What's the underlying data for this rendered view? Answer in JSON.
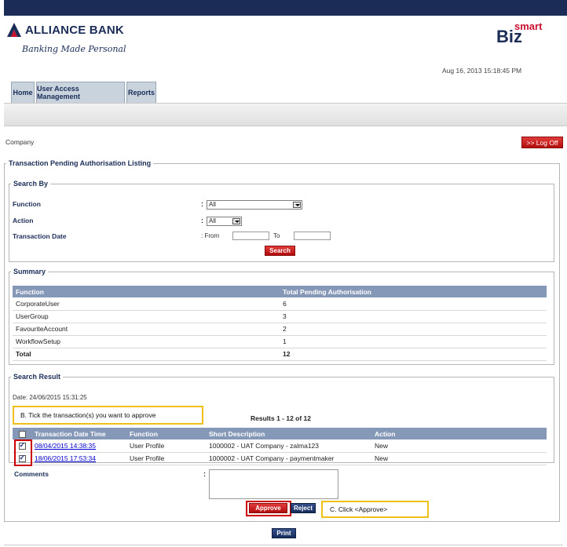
{
  "brand": {
    "name": "ALLIANCE BANK",
    "tagline": "Banking Made Personal",
    "biz": "Biz",
    "smart": "smart"
  },
  "header": {
    "datetime": "Aug 16, 2013 15:18:45 PM"
  },
  "tabs": [
    {
      "label": "Home"
    },
    {
      "label": "User Access Management"
    },
    {
      "label": "Reports"
    }
  ],
  "company_label": "Company",
  "logoff_label": ">> Log Off",
  "page_title": "Transaction Pending Authorisation Listing",
  "search_by": {
    "legend": "Search By",
    "function_label": "Function",
    "function_value": "All",
    "action_label": "Action",
    "action_value": "All",
    "date_label": "Transaction Date",
    "from_label": ": From",
    "to_label": "To",
    "colon": ":",
    "search_button": "Search"
  },
  "summary": {
    "legend": "Summary",
    "headers": [
      "Function",
      "Total Pending Authorisation"
    ],
    "rows": [
      [
        "CorporateUser",
        "6"
      ],
      [
        "UserGroup",
        "3"
      ],
      [
        "FavouriteAccount",
        "2"
      ],
      [
        "WorkflowSetup",
        "1"
      ]
    ],
    "total_label": "Total",
    "total_value": "12"
  },
  "search_result": {
    "legend": "Search Result",
    "date_text": "Date: 24/06/2015 15:31:25",
    "results_text": "Results 1 - 12 of 12",
    "headers": [
      "Transaction Date Time",
      "Function",
      "Short Description",
      "Action"
    ],
    "rows": [
      [
        "08/04/2015 14:38:35",
        "User Profile",
        "1000002 - UAT Company - zalma123",
        "New"
      ],
      [
        "18/06/2015 17:53:34",
        "User Profile",
        "1000002 - UAT Company - paymentmaker",
        "New"
      ]
    ],
    "comments_label": "Comments",
    "colon": ":",
    "approve_button": "Approve",
    "reject_button": "Reject",
    "print_button": "Print"
  },
  "callouts": {
    "b": "B.   Tick the transaction(s) you want to approve",
    "c": "C.   Click <Approve>"
  }
}
